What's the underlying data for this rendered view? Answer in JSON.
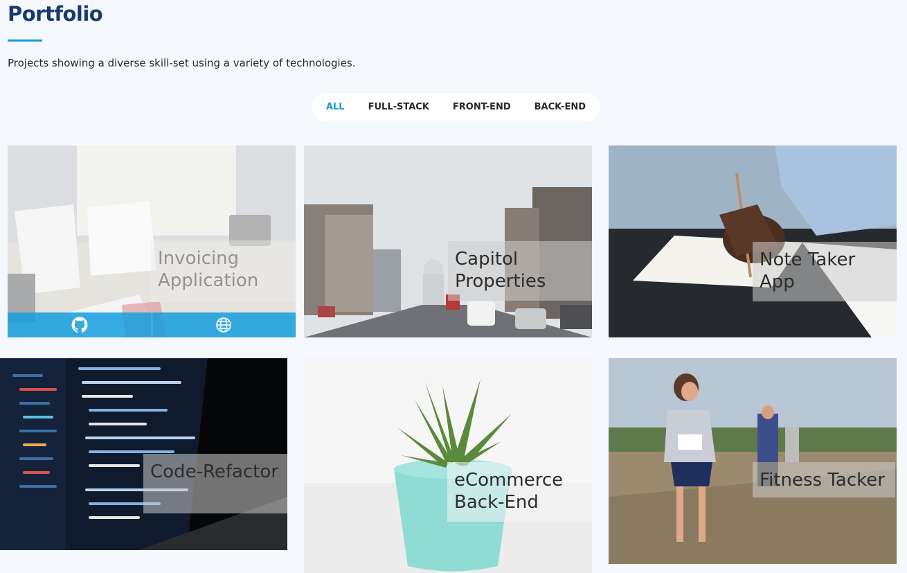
{
  "section": {
    "title": "Portfolio",
    "description": "Projects showing a diverse skill-set using a variety of technologies."
  },
  "filters": [
    {
      "label": "ALL",
      "active": true
    },
    {
      "label": "FULL-STACK",
      "active": false
    },
    {
      "label": "FRONT-END",
      "active": false
    },
    {
      "label": "BACK-END",
      "active": false
    }
  ],
  "colors": {
    "accent": "#149ddd",
    "title": "#173b6c",
    "background": "#f5f8fc"
  },
  "projects": [
    {
      "title": "Invoicing Application",
      "links": [
        "github-icon",
        "globe-icon"
      ]
    },
    {
      "title": "Capitol Properties"
    },
    {
      "title": "Note Taker App"
    },
    {
      "title": "Code-Refactor"
    },
    {
      "title": "eCommerce Back-End"
    },
    {
      "title": "Fitness Tacker"
    }
  ]
}
